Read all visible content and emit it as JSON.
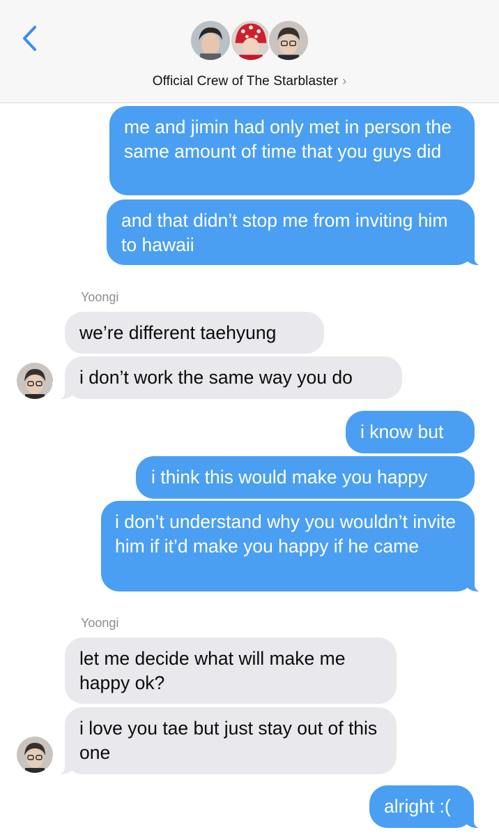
{
  "header": {
    "group_name": "Official Crew of The Starblaster",
    "chevron": "›",
    "back_icon": "chevron-left-icon",
    "accent_color": "#4a9ff2"
  },
  "colors": {
    "outgoing_bubble": "#4a9ff2",
    "incoming_bubble": "#e8e8ed",
    "header_bg": "#f7f7f8",
    "sender_label": "#8e8e93"
  },
  "messages": [
    {
      "direction": "outgoing",
      "text": "me and jimin had only met in person the same amount of time that you guys did"
    },
    {
      "direction": "outgoing",
      "text": "and that didn’t stop me from inviting him to hawaii"
    },
    {
      "direction": "incoming",
      "sender": "Yoongi",
      "text": "we’re different taehyung"
    },
    {
      "direction": "incoming",
      "text": "i don’t work the same way you do"
    },
    {
      "direction": "outgoing",
      "text": "i know but"
    },
    {
      "direction": "outgoing",
      "text": "i think this would make you happy"
    },
    {
      "direction": "outgoing",
      "text": "i don’t understand why you wouldn’t invite him if it’d make you happy if he came"
    },
    {
      "direction": "incoming",
      "sender": "Yoongi",
      "text": "let me decide what will make me happy ok?"
    },
    {
      "direction": "incoming",
      "text": "i love you tae but just stay out of this one"
    },
    {
      "direction": "outgoing",
      "text": "alright :("
    }
  ]
}
